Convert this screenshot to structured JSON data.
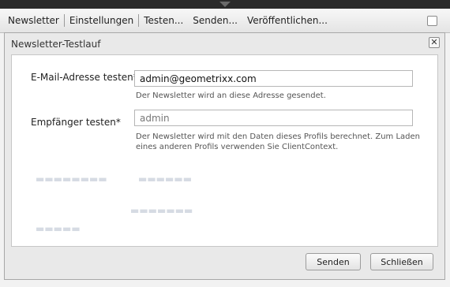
{
  "toolbar": {
    "items": [
      "Newsletter",
      "Einstellungen",
      "Testen...",
      "Senden...",
      "Veröffentlichen..."
    ]
  },
  "dialog": {
    "title": "Newsletter-Testlauf",
    "close_symbol": "✕",
    "fields": {
      "email": {
        "label": "E-Mail-Adresse testen*",
        "value": "admin@geometrixx.com",
        "help": "Der Newsletter wird an diese Adresse gesendet."
      },
      "recipient": {
        "label": "Empfänger testen*",
        "placeholder": "admin",
        "help": "Der Newsletter wird mit den Daten dieses Profils berechnet. Zum Laden eines anderen Profils verwenden Sie ClientContext."
      }
    },
    "buttons": {
      "send": "Senden",
      "close": "Schließen"
    }
  }
}
